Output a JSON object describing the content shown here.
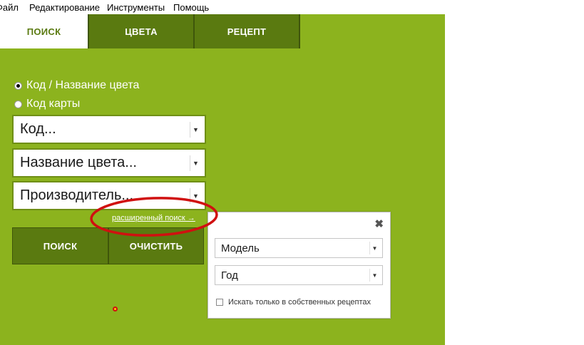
{
  "menu": {
    "file": "Файл",
    "edit": "Редактирование",
    "tools": "Инструменты",
    "help": "Помощь"
  },
  "tabs": [
    {
      "label": "ПОИСК",
      "active": true
    },
    {
      "label": "ЦВЕТА",
      "active": false
    },
    {
      "label": "РЕЦЕПТ",
      "active": false
    }
  ],
  "search": {
    "radio_code": {
      "label": "Код / Название цвета",
      "checked": true
    },
    "radio_card": {
      "label": "Код карты",
      "checked": false
    },
    "dropdown_code": "Код...",
    "dropdown_name": "Название цвета...",
    "dropdown_maker": "Производитель...",
    "advanced_link": "расширенный поиск →",
    "search_button": "ПОИСК",
    "clear_button": "ОЧИСТИТЬ"
  },
  "advanced_popup": {
    "close_glyph": "✖",
    "model_dropdown": "Модель",
    "year_dropdown": "Год",
    "own_recipes_checkbox": "Искать только в собственных рецептах",
    "own_recipes_checked": false
  },
  "colors": {
    "app_green": "#8cb31e",
    "dark_green": "#5a7a10",
    "annotation_red": "#d01010"
  },
  "icons": {
    "dropdown_arrow": "chevron-down-icon",
    "close": "close-icon"
  }
}
